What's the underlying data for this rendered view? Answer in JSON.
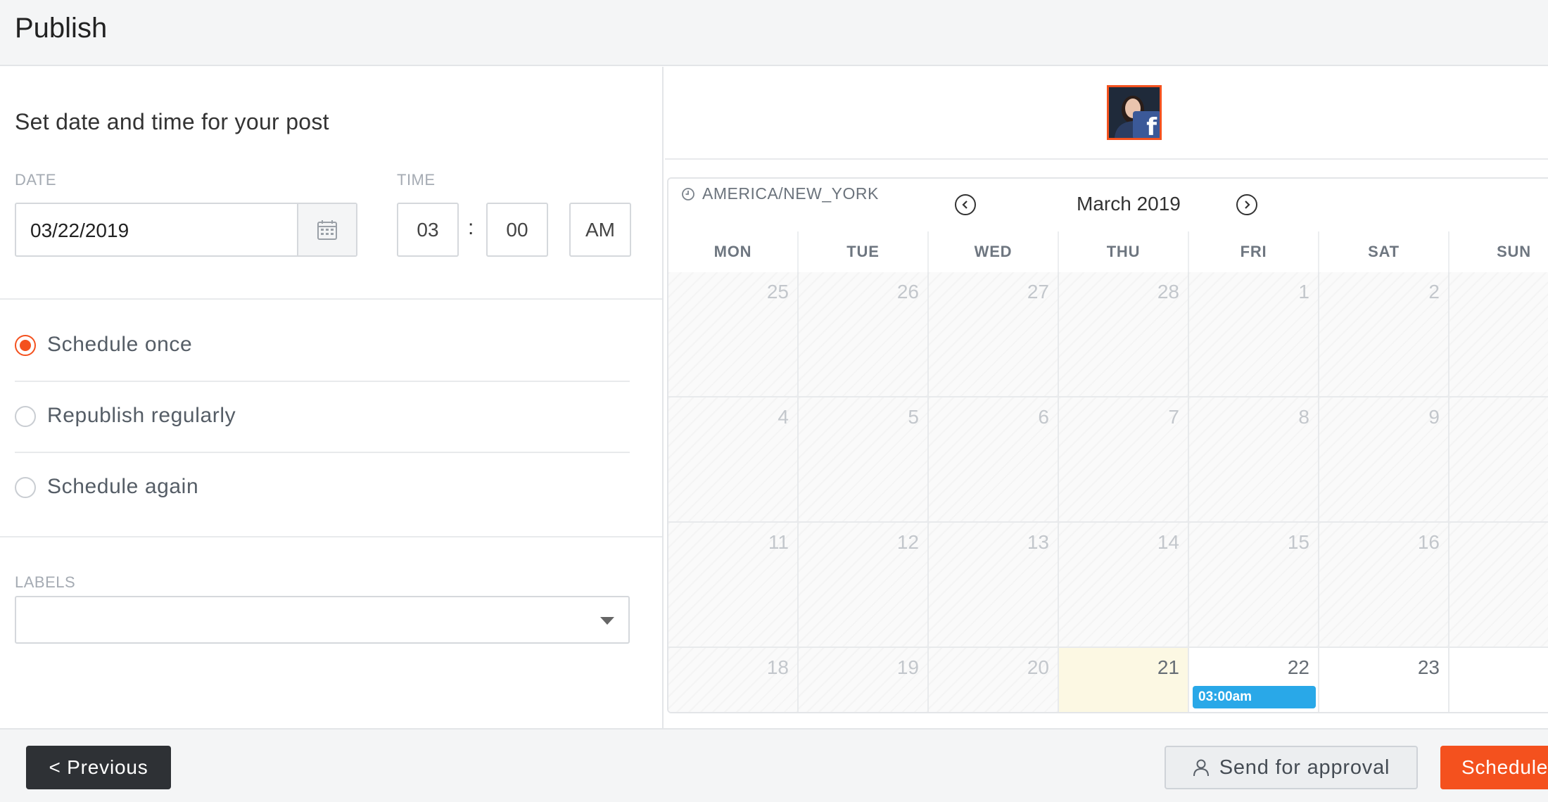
{
  "header": {
    "title": "Publish"
  },
  "form": {
    "section_title": "Set date and time for your post",
    "date_label": "DATE",
    "date_value": "03/22/2019",
    "time_label": "TIME",
    "hour": "03",
    "separator": ":",
    "minute": "00",
    "ampm": "AM",
    "options": [
      {
        "label": "Schedule once",
        "checked": true
      },
      {
        "label": "Republish regularly",
        "checked": false
      },
      {
        "label": "Schedule again",
        "checked": false
      }
    ],
    "labels_label": "LABELS",
    "labels_value": ""
  },
  "profile": {
    "network": "facebook",
    "network_glyph": "f"
  },
  "calendar": {
    "timezone": "AMERICA/NEW_YORK",
    "month": "March 2019",
    "days": [
      "MON",
      "TUE",
      "WED",
      "THU",
      "FRI",
      "SAT",
      "SUN"
    ],
    "weeks": [
      [
        "25",
        "26",
        "27",
        "28",
        "1",
        "2",
        ""
      ],
      [
        "4",
        "5",
        "6",
        "7",
        "8",
        "9",
        ""
      ],
      [
        "11",
        "12",
        "13",
        "14",
        "15",
        "16",
        ""
      ],
      [
        "18",
        "19",
        "20",
        "21",
        "22",
        "23",
        ""
      ]
    ],
    "today": "21",
    "event": {
      "day": "22",
      "time": "03:00am"
    }
  },
  "footer": {
    "previous": "< Previous",
    "send_for_approval": "Send for approval",
    "schedule": "Schedule"
  },
  "colors": {
    "accent": "#f4511e",
    "event": "#29a8e8",
    "today_bg": "#fcf8e3",
    "facebook": "#3b5998",
    "dark_button": "#2e3135"
  }
}
